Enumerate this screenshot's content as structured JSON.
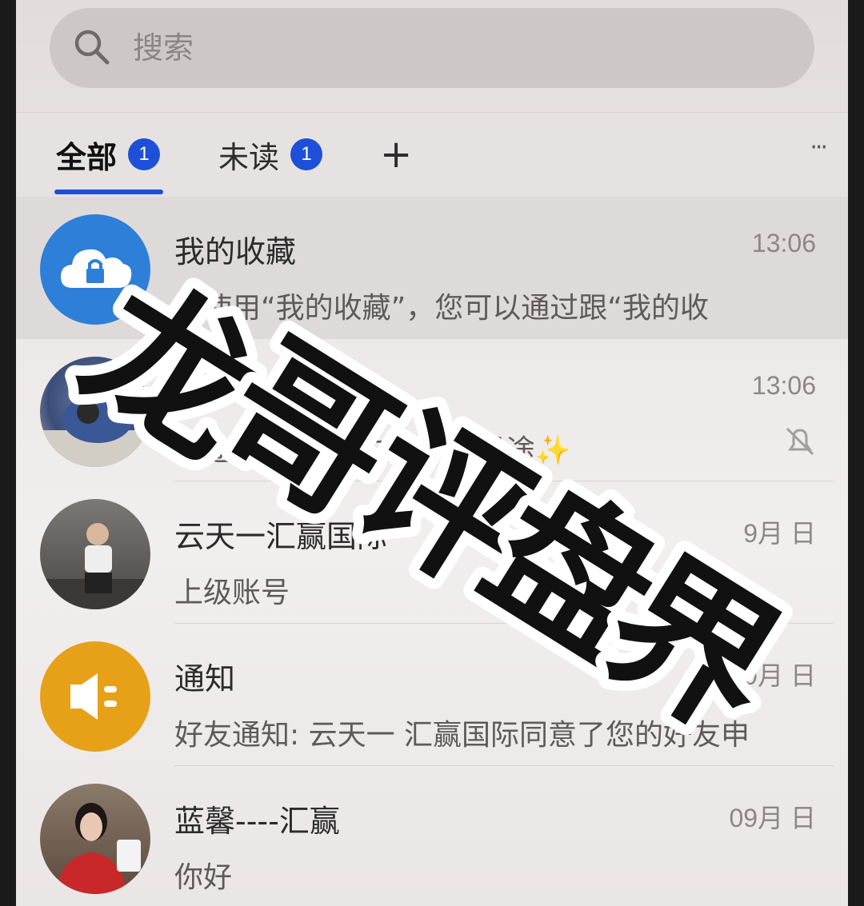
{
  "search": {
    "placeholder": "搜索"
  },
  "tabs": [
    {
      "label": "全部",
      "badge": "1",
      "active": true
    },
    {
      "label": "未读",
      "badge": "1",
      "active": false
    }
  ],
  "tab_actions": {
    "add": "+",
    "more": "···"
  },
  "conversations": [
    {
      "name": "我的收藏",
      "preview": "如使用“我的收藏”，您可以通过跟“我的收",
      "time": "13:06",
      "avatar": "cloud-lock-icon"
    },
    {
      "name": "",
      "preview": "星途✨ … 从远方来, @星途✨",
      "time": "13:06",
      "avatar": "photo",
      "muted": true
    },
    {
      "name": "云天一汇赢国际",
      "preview": "上级账号",
      "time": "9月 日",
      "avatar": "photo"
    },
    {
      "name": "通知",
      "preview": "好友通知: 云天一 汇赢国际同意了您的好友申",
      "time": "09月  日",
      "avatar": "speaker-icon"
    },
    {
      "name": "蓝馨----汇赢",
      "preview": "你好",
      "time": "09月  日",
      "avatar": "photo"
    }
  ],
  "watermark": {
    "text": "龙哥评盘界"
  },
  "colors": {
    "accent": "#1d4fd8",
    "notice": "#e6a118",
    "collect": "#2d7fd8"
  }
}
